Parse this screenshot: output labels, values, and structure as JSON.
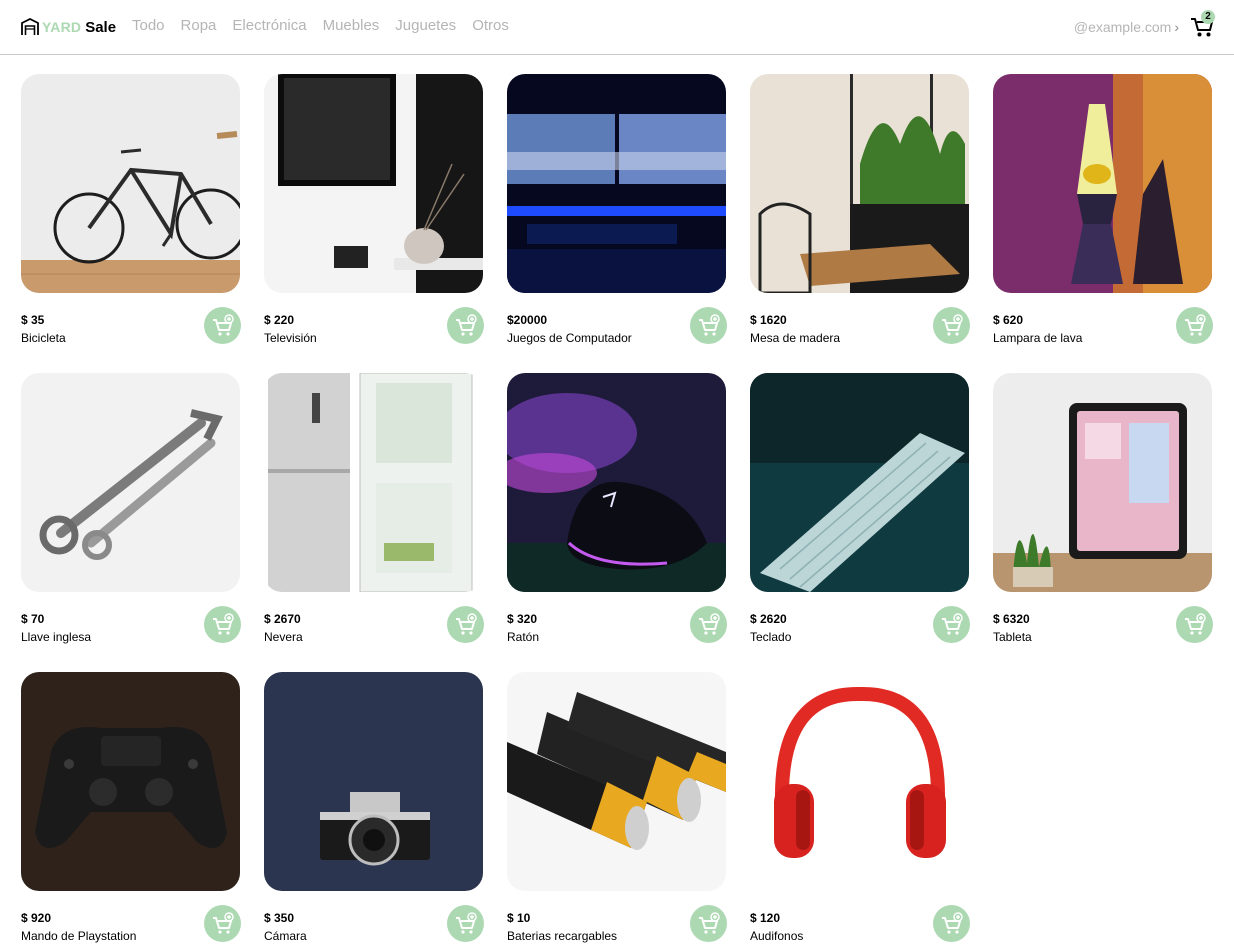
{
  "header": {
    "logo_yard": "YARD",
    "logo_sale": "Sale",
    "nav": [
      "Todo",
      "Ropa",
      "Electrónica",
      "Muebles",
      "Juguetes",
      "Otros"
    ],
    "account_email": "@example.com",
    "cart_count": "2"
  },
  "colors": {
    "accent": "#acd9b2",
    "muted_text": "#b5b5b5"
  },
  "products": [
    {
      "price": "$ 35",
      "name": "Bicicleta",
      "image": "bicycle"
    },
    {
      "price": "$ 220",
      "name": "Televisión",
      "image": "tv"
    },
    {
      "price": "$20000",
      "name": "Juegos de Computador",
      "image": "computer-setup"
    },
    {
      "price": "$ 1620",
      "name": "Mesa de madera",
      "image": "wooden-table"
    },
    {
      "price": "$ 620",
      "name": "Lampara de lava",
      "image": "lava-lamp"
    },
    {
      "price": "$ 70",
      "name": "Llave inglesa",
      "image": "wrenches"
    },
    {
      "price": "$ 2670",
      "name": "Nevera",
      "image": "fridge"
    },
    {
      "price": "$ 320",
      "name": "Ratón",
      "image": "mouse"
    },
    {
      "price": "$ 2620",
      "name": "Teclado",
      "image": "keyboard"
    },
    {
      "price": "$ 6320",
      "name": "Tableta",
      "image": "tablet"
    },
    {
      "price": "$ 920",
      "name": "Mando de Playstation",
      "image": "gamepad"
    },
    {
      "price": "$ 350",
      "name": "Cámara",
      "image": "camera"
    },
    {
      "price": "$ 10",
      "name": "Baterias recargables",
      "image": "batteries"
    },
    {
      "price": "$ 120",
      "name": "Audifonos",
      "image": "headphones"
    }
  ]
}
